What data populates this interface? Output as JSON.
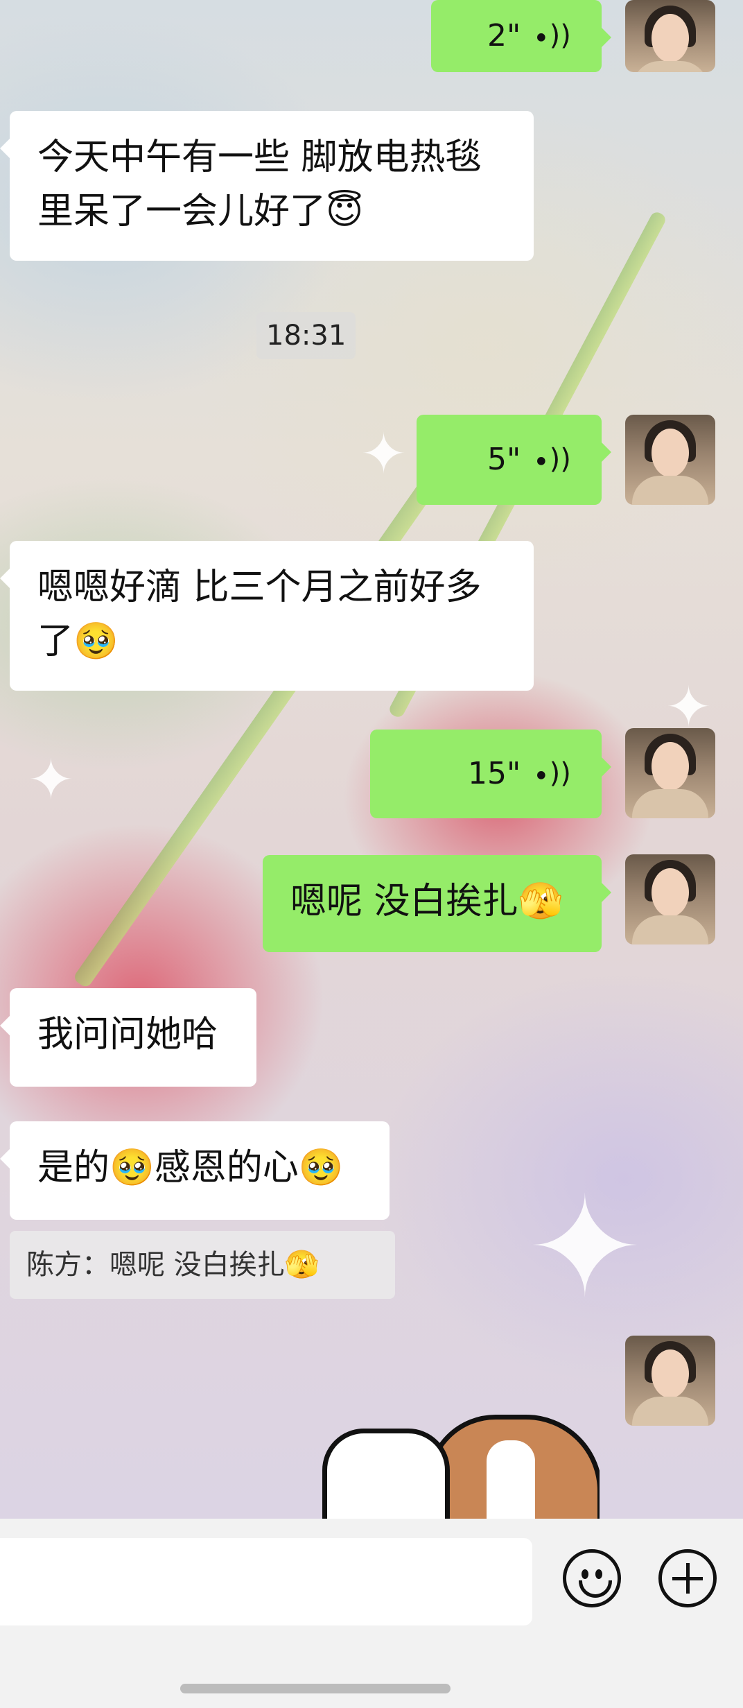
{
  "messages": [
    {
      "id": "m1",
      "side": "out",
      "type": "voice",
      "duration": "2\""
    },
    {
      "id": "m2",
      "side": "in",
      "type": "text",
      "text": "今天中午有一些 脚放电热毯里呆了一会儿好了😇"
    },
    {
      "id": "t1",
      "type": "time",
      "text": "18:31"
    },
    {
      "id": "m3",
      "side": "out",
      "type": "voice",
      "duration": "5\""
    },
    {
      "id": "m4",
      "side": "in",
      "type": "text",
      "text": "嗯嗯好滴 比三个月之前好多了🥹"
    },
    {
      "id": "m5",
      "side": "out",
      "type": "voice",
      "duration": "15\""
    },
    {
      "id": "m6",
      "side": "out",
      "type": "text",
      "text": "嗯呢 没白挨扎🫣"
    },
    {
      "id": "m7",
      "side": "in",
      "type": "text",
      "text": "我问问她哈"
    },
    {
      "id": "m8",
      "side": "in",
      "type": "text",
      "text": "是的🥹感恩的心🥹",
      "quote": "陈方：嗯呢 没白挨扎🫣"
    },
    {
      "id": "m9",
      "side": "out",
      "type": "sticker"
    }
  ],
  "voice_wave_glyph": "((•",
  "input_bar": {
    "emoji_icon": "smiley-face-icon",
    "plus_icon": "plus-circle-icon"
  }
}
